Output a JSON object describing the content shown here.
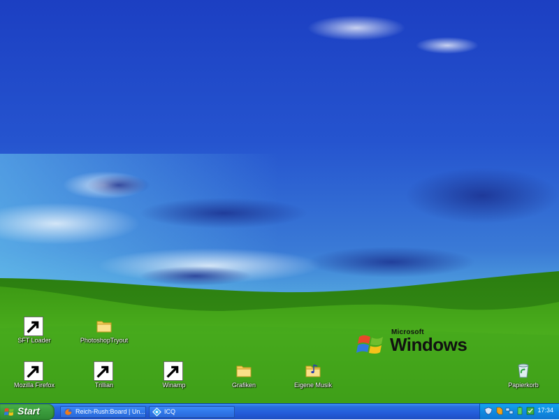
{
  "desktop": {
    "icons": [
      {
        "label": "SFT Loader",
        "icon": "sft-loader-icon"
      },
      {
        "label": "PhotoshopTryout",
        "icon": "folder-icon"
      },
      {
        "label": "Mozilla Firefox",
        "icon": "firefox-icon"
      },
      {
        "label": "Trillian",
        "icon": "trillian-icon"
      },
      {
        "label": "Winamp",
        "icon": "winamp-icon"
      },
      {
        "label": "Grafiken",
        "icon": "folder-icon"
      },
      {
        "label": "Eigene Musik",
        "icon": "music-folder-icon"
      },
      {
        "label": "Papierkorb",
        "icon": "recycle-bin-icon"
      }
    ],
    "brand": {
      "small": "Microsoft",
      "big": "Windows"
    }
  },
  "taskbar": {
    "start_label": "Start",
    "tasks": [
      {
        "label": "Reich-Rush:Board | Un...",
        "icon": "firefox-icon"
      },
      {
        "label": "ICQ",
        "icon": "icq-icon"
      }
    ],
    "tray": {
      "icons": [
        "shield-icon",
        "winamp-icon",
        "network-icon",
        "battery-icon",
        "app-icon"
      ],
      "clock": "17:34"
    }
  },
  "colors": {
    "sky_top": "#1f44c6",
    "grass": "#3f9a1a",
    "taskbar": "#245edb",
    "start_green": "#3c9e3e",
    "tray": "#0f8ae0"
  }
}
